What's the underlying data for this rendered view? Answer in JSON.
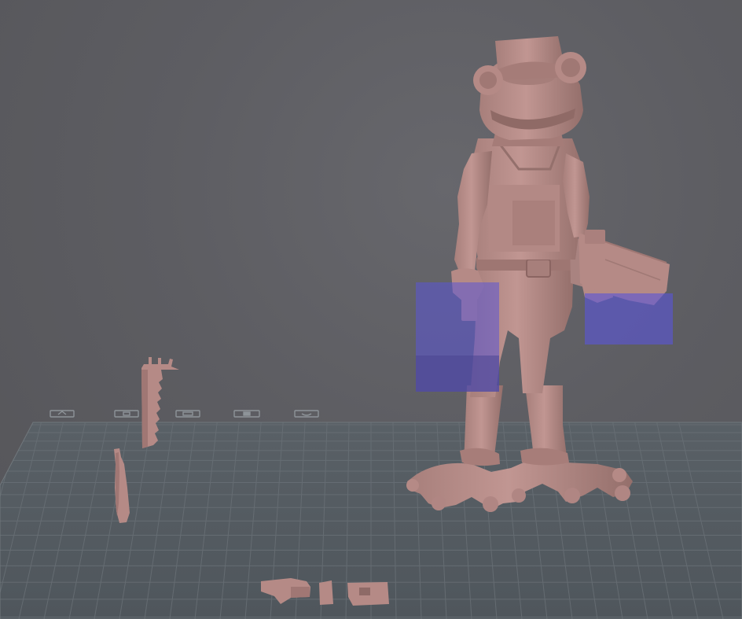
{
  "viewport": {
    "background_color": "#5c5c61",
    "bed_color": "#4f555b",
    "grid_line_color": "#6a7177",
    "model_color": "#b58a86",
    "support_block_color": "#5b55d6"
  },
  "objects": [
    {
      "name": "frog-figure-model",
      "kind": "main-figure"
    },
    {
      "name": "saw-part-model",
      "kind": "part"
    },
    {
      "name": "handle-part-model",
      "kind": "part"
    },
    {
      "name": "bottom-parts-group",
      "kind": "parts"
    }
  ],
  "highlights": [
    {
      "name": "selection-box-left-hand"
    },
    {
      "name": "selection-box-right-hand"
    }
  ],
  "bed_icons": [
    "bed-icon-1",
    "bed-icon-2",
    "bed-icon-3",
    "bed-icon-4",
    "bed-icon-5"
  ]
}
